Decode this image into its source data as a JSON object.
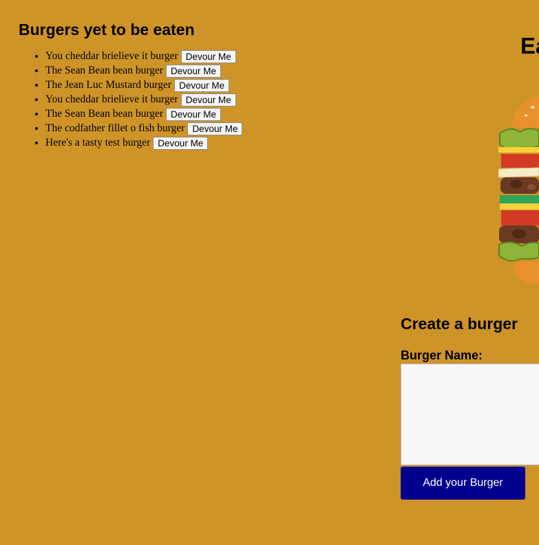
{
  "uneaten": {
    "heading": "Burgers yet to be eaten",
    "devour_label": "Devour Me",
    "items": [
      "You cheddar brielieve it burger",
      "The Sean Bean bean burger",
      "The Jean Luc Mustard burger",
      "You cheddar brielieve it burger",
      "The Sean Bean bean burger",
      "The codfather fillet o fish burger",
      "Here's a tasty test burger"
    ]
  },
  "header": {
    "title_visible": "Ea"
  },
  "create": {
    "heading": "Create a burger",
    "name_label": "Burger Name:",
    "submit_label": "Add your Burger"
  },
  "colors": {
    "background": "#cf9427",
    "submit_button": "#00008f"
  },
  "icons": {
    "hero_image": "burger-illustration"
  }
}
